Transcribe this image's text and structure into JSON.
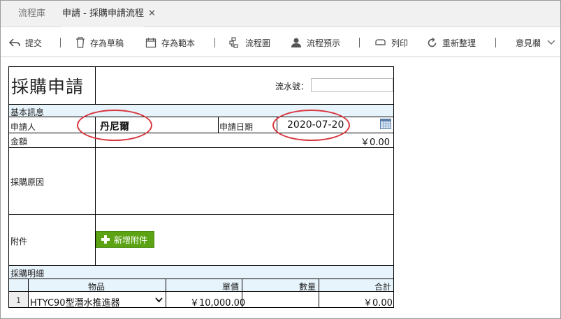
{
  "tabs": [
    {
      "label": "流程庫"
    },
    {
      "label": "申請 - 採購申請流程"
    }
  ],
  "toolbar": {
    "submit": "提交",
    "save_draft": "存為草稿",
    "save_template": "存為範本",
    "flowchart": "流程圖",
    "preview": "流程預示",
    "print": "列印",
    "refresh": "重新整理",
    "comments": "意見欄"
  },
  "form": {
    "title": "採購申請",
    "serial_label": "流水號：",
    "section_basic": "基本訊息",
    "applicant_label": "申請人",
    "applicant_value": "丹尼爾",
    "date_label": "申請日期",
    "date_value": "2020-07-20",
    "amount_label": "金額",
    "amount_value": "￥0.00",
    "reason_label": "採購原因",
    "attachment_label": "附件",
    "add_attachment": "新增附件",
    "section_detail": "採購明細",
    "columns": {
      "item": "物品",
      "unit_price": "單價",
      "quantity": "數量",
      "total": "合計"
    },
    "rows": [
      {
        "index": "1",
        "item": "HTYC90型潛水推進器",
        "unit_price": "￥10,000.00",
        "quantity": "",
        "total": "￥0.00"
      }
    ]
  },
  "colors": {
    "highlight": "#d9363e",
    "section_bg": "#e8f4fb",
    "button_green": "#5ca314"
  }
}
